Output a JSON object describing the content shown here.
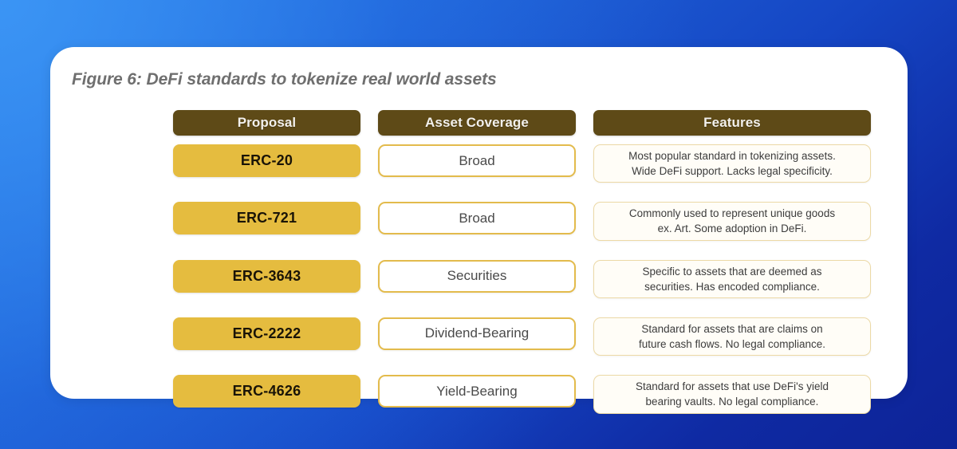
{
  "figure": {
    "title": "Figure 6: DeFi standards to tokenize real world assets"
  },
  "colors": {
    "header_brown": "#5e4a17",
    "proposal_gold": "#e5bc3f",
    "asset_border": "#e3bb4c",
    "features_border": "#ecd9a6",
    "features_bg": "#fffdf7",
    "card_bg": "#ffffff",
    "page_blue_light": "#2a7de8",
    "page_blue_dark": "#0d2397",
    "title_gray": "#6f6f6f"
  },
  "table": {
    "headers": {
      "proposal": "Proposal",
      "asset_coverage": "Asset Coverage",
      "features": "Features"
    },
    "rows": [
      {
        "proposal": "ERC-20",
        "asset_coverage": "Broad",
        "features_line1": "Most popular standard in tokenizing assets.",
        "features_line2": "Wide DeFi support. Lacks legal specificity."
      },
      {
        "proposal": "ERC-721",
        "asset_coverage": "Broad",
        "features_line1": "Commonly used to represent unique goods",
        "features_line2": "ex. Art. Some adoption in DeFi."
      },
      {
        "proposal": "ERC-3643",
        "asset_coverage": "Securities",
        "features_line1": "Specific to assets that are deemed as",
        "features_line2": "securities. Has encoded compliance."
      },
      {
        "proposal": "ERC-2222",
        "asset_coverage": "Dividend-Bearing",
        "features_line1": "Standard for assets that are claims on",
        "features_line2": "future cash flows. No legal compliance."
      },
      {
        "proposal": "ERC-4626",
        "asset_coverage": "Yield-Bearing",
        "features_line1": "Standard for assets that use DeFi's yield",
        "features_line2": "bearing vaults. No legal compliance."
      }
    ]
  }
}
